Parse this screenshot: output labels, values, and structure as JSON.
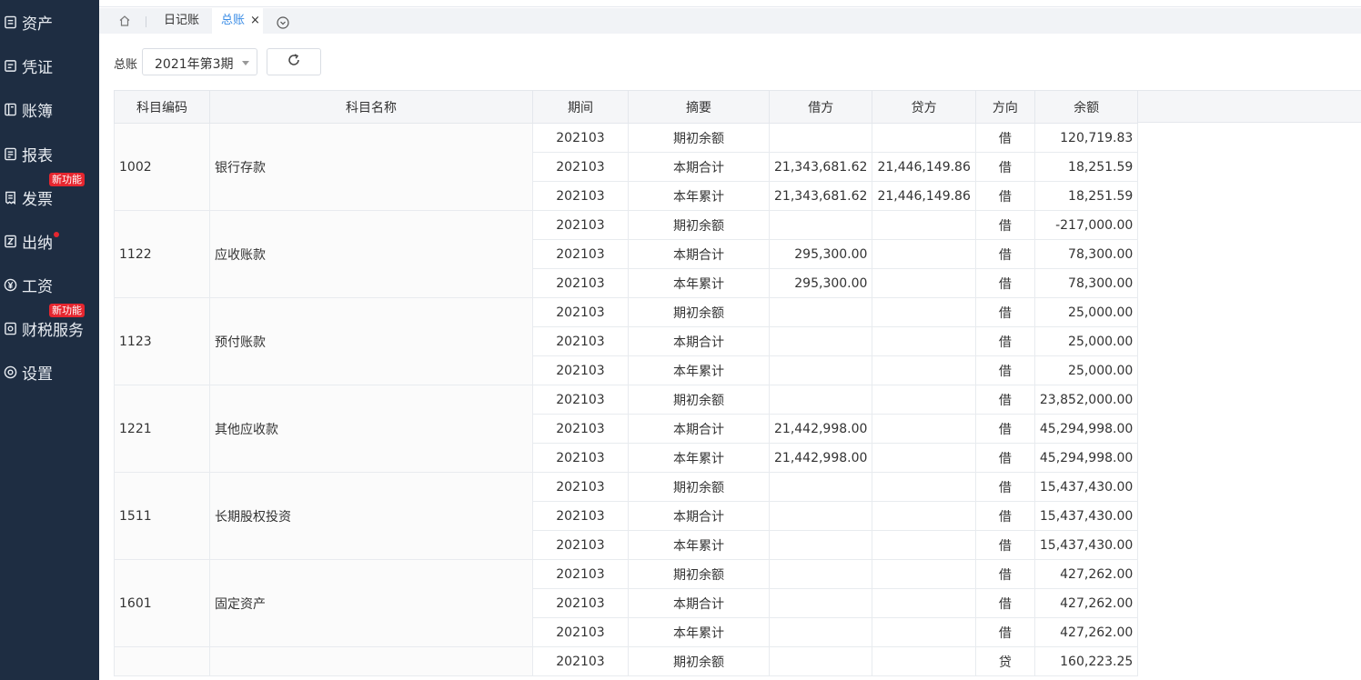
{
  "sidebar": {
    "items": [
      {
        "label": "资产",
        "icon": "asset-icon"
      },
      {
        "label": "凭证",
        "icon": "voucher-icon"
      },
      {
        "label": "账簿",
        "icon": "ledger-book-icon"
      },
      {
        "label": "报表",
        "icon": "report-icon"
      },
      {
        "label": "发票",
        "icon": "invoice-icon",
        "badge": "新功能"
      },
      {
        "label": "出纳",
        "icon": "cashier-icon",
        "dot": true
      },
      {
        "label": "工资",
        "icon": "yen-icon"
      },
      {
        "label": "财税服务",
        "icon": "tax-service-icon",
        "badge": "新功能"
      },
      {
        "label": "设置",
        "icon": "settings-icon"
      }
    ]
  },
  "tabs": {
    "items": [
      {
        "label": "日记账",
        "active": false
      },
      {
        "label": "总账",
        "active": true
      }
    ],
    "close_glyph": "×"
  },
  "filter": {
    "label": "总账",
    "period_value": "2021年第3期"
  },
  "table": {
    "headers": [
      "科目编码",
      "科目名称",
      "期间",
      "摘要",
      "借方",
      "贷方",
      "方向",
      "余额"
    ],
    "groups": [
      {
        "code": "1002",
        "name": "银行存款",
        "rows": [
          {
            "period": "202103",
            "summary": "期初余额",
            "debit": "",
            "credit": "",
            "direction": "借",
            "balance": "120,719.83"
          },
          {
            "period": "202103",
            "summary": "本期合计",
            "debit": "21,343,681.62",
            "credit": "21,446,149.86",
            "direction": "借",
            "balance": "18,251.59"
          },
          {
            "period": "202103",
            "summary": "本年累计",
            "debit": "21,343,681.62",
            "credit": "21,446,149.86",
            "direction": "借",
            "balance": "18,251.59"
          }
        ]
      },
      {
        "code": "1122",
        "name": "应收账款",
        "rows": [
          {
            "period": "202103",
            "summary": "期初余额",
            "debit": "",
            "credit": "",
            "direction": "借",
            "balance": "-217,000.00"
          },
          {
            "period": "202103",
            "summary": "本期合计",
            "debit": "295,300.00",
            "credit": "",
            "direction": "借",
            "balance": "78,300.00"
          },
          {
            "period": "202103",
            "summary": "本年累计",
            "debit": "295,300.00",
            "credit": "",
            "direction": "借",
            "balance": "78,300.00"
          }
        ]
      },
      {
        "code": "1123",
        "name": "预付账款",
        "rows": [
          {
            "period": "202103",
            "summary": "期初余额",
            "debit": "",
            "credit": "",
            "direction": "借",
            "balance": "25,000.00"
          },
          {
            "period": "202103",
            "summary": "本期合计",
            "debit": "",
            "credit": "",
            "direction": "借",
            "balance": "25,000.00"
          },
          {
            "period": "202103",
            "summary": "本年累计",
            "debit": "",
            "credit": "",
            "direction": "借",
            "balance": "25,000.00"
          }
        ]
      },
      {
        "code": "1221",
        "name": "其他应收款",
        "rows": [
          {
            "period": "202103",
            "summary": "期初余额",
            "debit": "",
            "credit": "",
            "direction": "借",
            "balance": "23,852,000.00"
          },
          {
            "period": "202103",
            "summary": "本期合计",
            "debit": "21,442,998.00",
            "credit": "",
            "direction": "借",
            "balance": "45,294,998.00"
          },
          {
            "period": "202103",
            "summary": "本年累计",
            "debit": "21,442,998.00",
            "credit": "",
            "direction": "借",
            "balance": "45,294,998.00"
          }
        ]
      },
      {
        "code": "1511",
        "name": "长期股权投资",
        "rows": [
          {
            "period": "202103",
            "summary": "期初余额",
            "debit": "",
            "credit": "",
            "direction": "借",
            "balance": "15,437,430.00"
          },
          {
            "period": "202103",
            "summary": "本期合计",
            "debit": "",
            "credit": "",
            "direction": "借",
            "balance": "15,437,430.00"
          },
          {
            "period": "202103",
            "summary": "本年累计",
            "debit": "",
            "credit": "",
            "direction": "借",
            "balance": "15,437,430.00"
          }
        ]
      },
      {
        "code": "1601",
        "name": "固定资产",
        "rows": [
          {
            "period": "202103",
            "summary": "期初余额",
            "debit": "",
            "credit": "",
            "direction": "借",
            "balance": "427,262.00"
          },
          {
            "period": "202103",
            "summary": "本期合计",
            "debit": "",
            "credit": "",
            "direction": "借",
            "balance": "427,262.00"
          },
          {
            "period": "202103",
            "summary": "本年累计",
            "debit": "",
            "credit": "",
            "direction": "借",
            "balance": "427,262.00"
          }
        ]
      },
      {
        "code": "",
        "name": "",
        "rows": [
          {
            "period": "202103",
            "summary": "期初余额",
            "debit": "",
            "credit": "",
            "direction": "贷",
            "balance": "160,223.25"
          }
        ]
      }
    ]
  }
}
